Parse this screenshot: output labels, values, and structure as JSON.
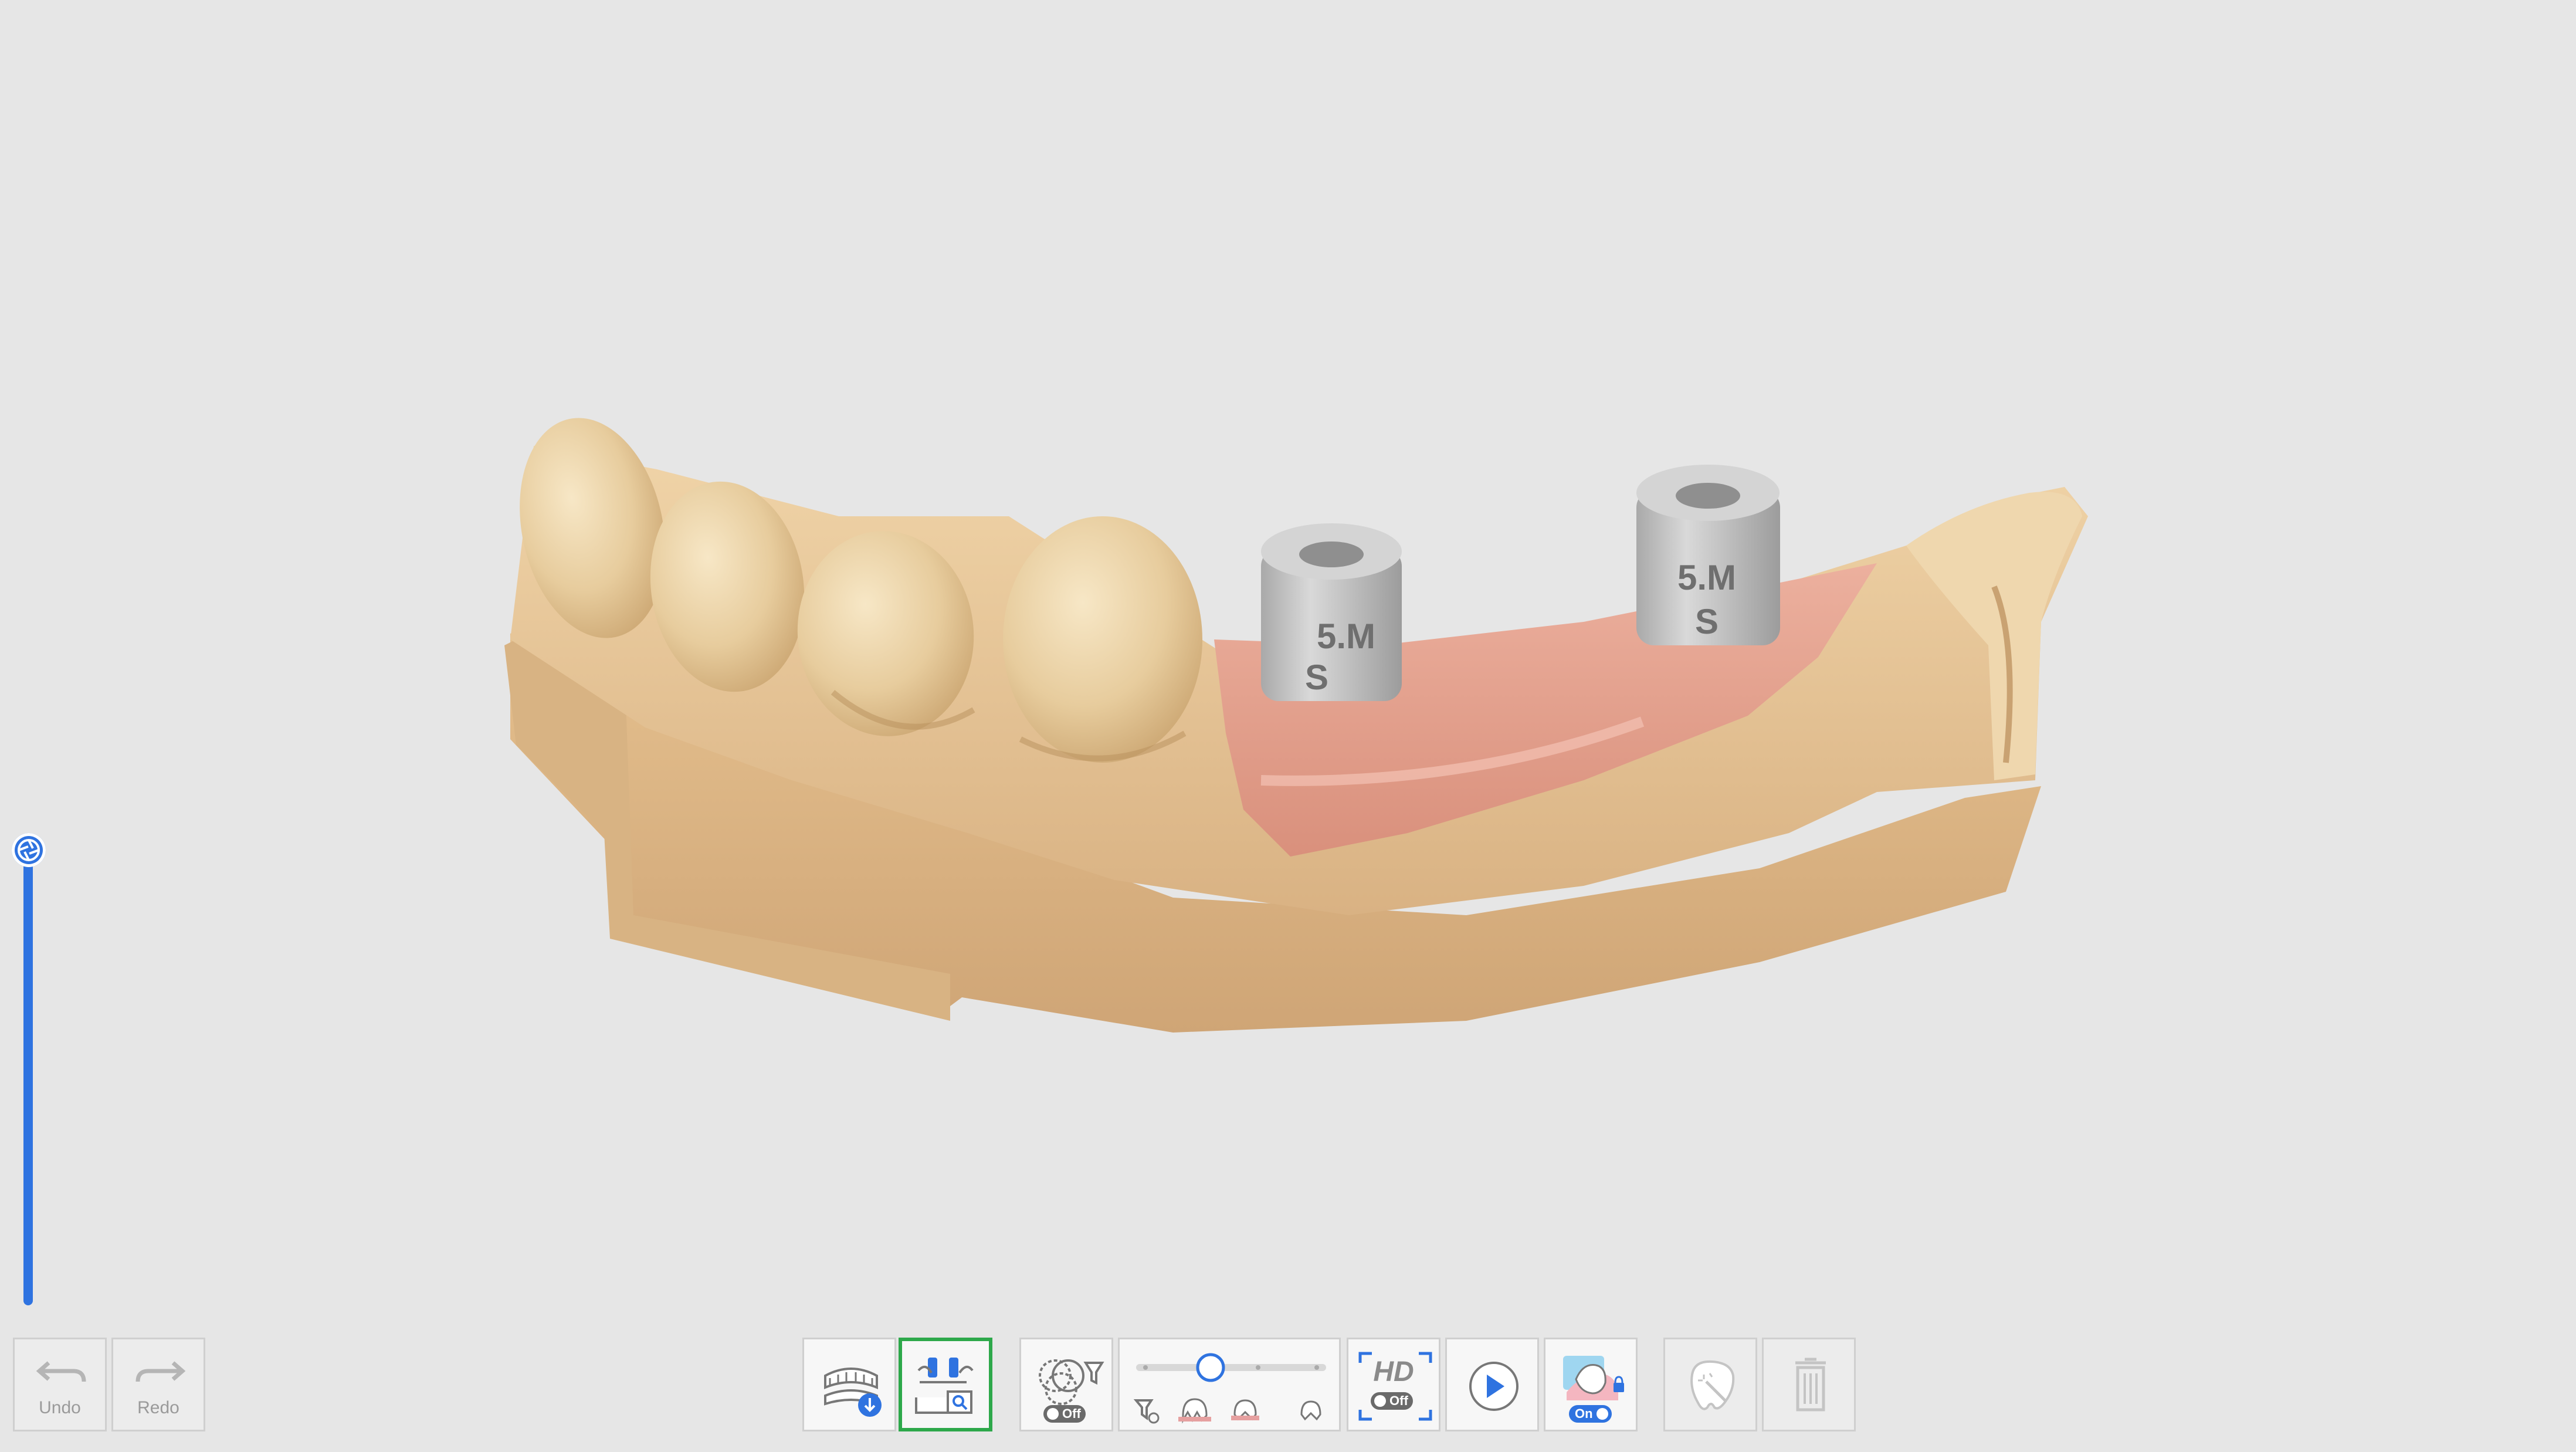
{
  "viewport": {
    "background": "#e6e6e6",
    "model": "dental-scan-lower-jaw"
  },
  "scan_bodies": [
    {
      "line1": "5.M",
      "line2": "S"
    },
    {
      "line1": "5.M",
      "line2": "S"
    }
  ],
  "history": {
    "undo_label": "Undo",
    "redo_label": "Redo"
  },
  "toolbar": {
    "icons": [
      "arch-download-icon",
      "scanbody-search-icon",
      "filter-overlap-icon",
      "filter-level-slider-icon",
      "hd-mode-icon",
      "play-icon",
      "tooth-lock-icon",
      "tooth-magic-icon",
      "trash-icon"
    ],
    "filter_toggle": "Off",
    "hd_label": "HD",
    "hd_toggle": "Off",
    "lock_toggle": "On",
    "filter_slider_level": 0.38
  },
  "colors": {
    "accent": "#2f73e0",
    "active_border": "#2da84a",
    "gum": "#e2a290",
    "stone": "#e8c79a",
    "scanbody": "#c9c9c9"
  }
}
